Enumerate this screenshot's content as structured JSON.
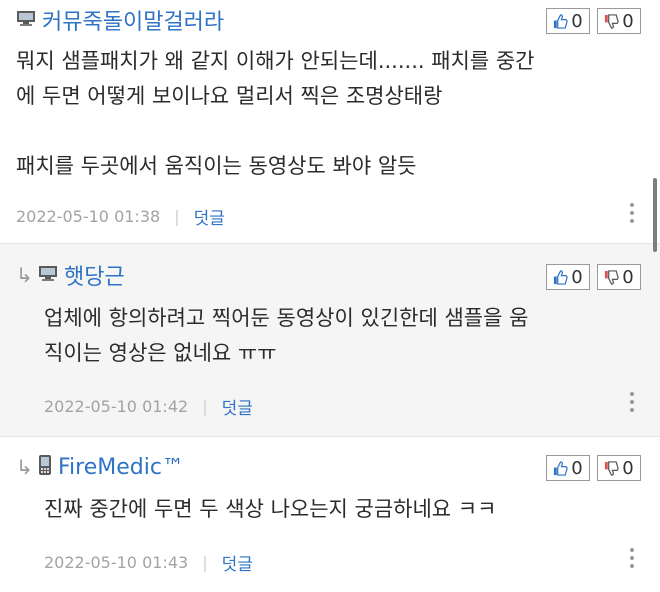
{
  "comments": [
    {
      "author": "커뮤죽돌이말걸러라",
      "device_icon": "computer-icon",
      "upvotes": "0",
      "downvotes": "0",
      "lines": "뭐지 샘플패치가 왜 같지 이해가 안되는데....... 패치를 중간\n에 두면 어떻게 보이나요 멀리서 찍은 조명상태랑\n\n패치를 두곳에서 움직이는 동영상도 봐야 알듯",
      "date": "2022-05-10 01:38",
      "reply_label": "덧글"
    },
    {
      "author": "햇당근",
      "device_icon": "computer-icon",
      "is_reply": true,
      "upvotes": "0",
      "downvotes": "0",
      "lines": "업체에 항의하려고 찍어둔 동영상이 있긴한데 샘플을 움\n직이는 영상은 없네요 ㅠㅠ",
      "date": "2022-05-10 01:42",
      "reply_label": "덧글"
    },
    {
      "author": "FireMedic™",
      "device_icon": "mobile-phone-icon",
      "is_reply": true,
      "upvotes": "0",
      "downvotes": "0",
      "lines": "진짜 중간에 두면 두 색상 나오는지 궁금하네요 ㅋㅋ",
      "date": "2022-05-10 01:43",
      "reply_label": "덧글"
    }
  ],
  "colors": {
    "username": "#2f73c5",
    "reply_background": "#f5f5f5",
    "thumb_up": "#2f73c5",
    "thumb_down": "#d9534f"
  }
}
